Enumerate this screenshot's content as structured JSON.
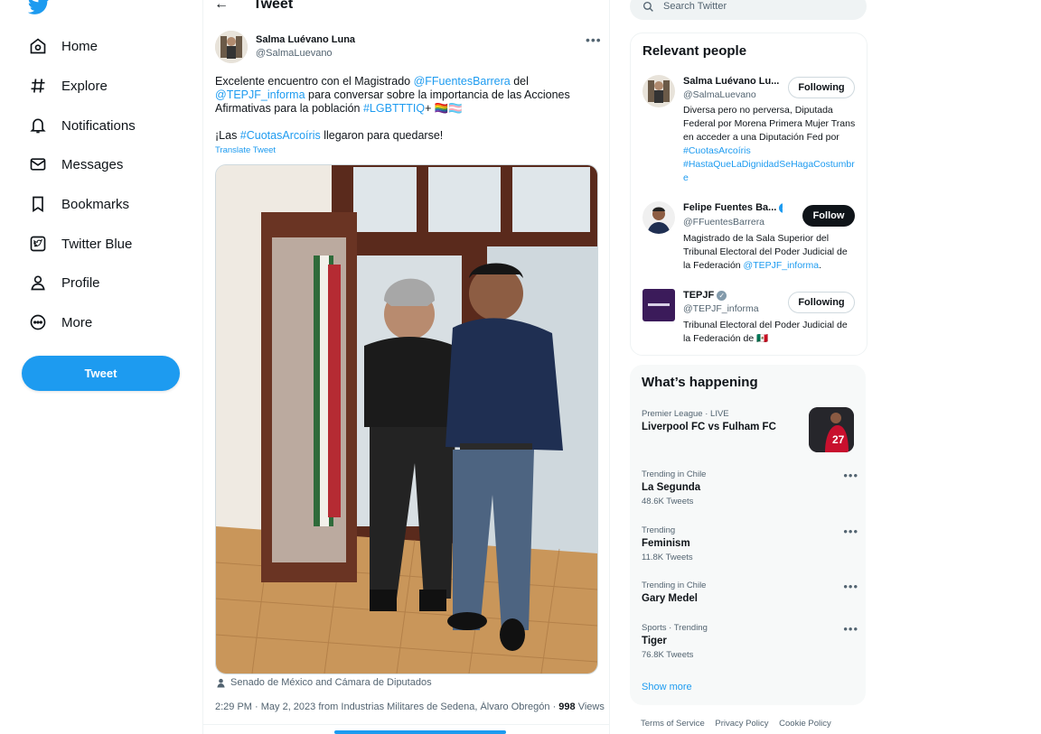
{
  "nav": {
    "logo": "twitter-bird-icon",
    "items": [
      {
        "label": "Home",
        "icon": "home-icon"
      },
      {
        "label": "Explore",
        "icon": "hashtag-icon"
      },
      {
        "label": "Notifications",
        "icon": "bell-icon"
      },
      {
        "label": "Messages",
        "icon": "envelope-icon"
      },
      {
        "label": "Bookmarks",
        "icon": "bookmark-icon"
      },
      {
        "label": "Twitter Blue",
        "icon": "twitter-blue-icon"
      },
      {
        "label": "Profile",
        "icon": "person-icon"
      },
      {
        "label": "More",
        "icon": "more-circle-icon"
      }
    ],
    "tweet_button": "Tweet"
  },
  "header": {
    "title": "Tweet"
  },
  "tweet": {
    "author_name": "Salma Luévano Luna",
    "author_handle": "@SalmaLuevano",
    "text_parts": {
      "p1_a": "Excelente encuentro con el Magistrado ",
      "p1_mention1": "@FFuentesBarrera",
      "p1_b": " del ",
      "p1_mention2": "@TEPJF_informa",
      "p1_c": " para conversar sobre la importancia de las Acciones Afirmativas para la población ",
      "p1_hashtag": "#LGBTTTIQ",
      "p1_d": "+ 🏳️‍🌈🏳️‍⚧️",
      "p2_a": "¡Las ",
      "p2_hashtag": "#CuotasArcoíris",
      "p2_b": " llegaron para quedarse!"
    },
    "translate": "Translate Tweet",
    "location": "Senado de México and Cámara de Diputados",
    "meta_text": "2:29 PM · May 2, 2023 from Industrias Militares de Sedena, Álvaro Obregón · ",
    "views_count": "998",
    "views_label": " Views"
  },
  "search": {
    "placeholder": "Search Twitter"
  },
  "relevant": {
    "title": "Relevant people",
    "people": [
      {
        "name": "Salma Luévano Lu...",
        "handle": "@SalmaLuevano",
        "button": "Following",
        "bio_text": "Diversa pero no perversa, Diputada Federal por Morena Primera Mujer Trans en acceder a una Diputación Fed por ",
        "bio_link1": "#CuotasArcoíris",
        "bio_link2": "#HastaQueLaDignidadSeHagaCostumbre"
      },
      {
        "name": "Felipe Fuentes Ba...",
        "handle": "@FFuentesBarrera",
        "button": "Follow",
        "bio_text": "Magistrado de la Sala Superior del Tribunal Electoral del Poder Judicial de la Federación ",
        "bio_link1": "@TEPJF_informa",
        "bio_after": "."
      },
      {
        "name": "TEPJF",
        "handle": "@TEPJF_informa",
        "button": "Following",
        "bio_text": "Tribunal Electoral del Poder Judicial de la Federación de 🇲🇽"
      }
    ]
  },
  "happening": {
    "title": "What’s happening",
    "trends": [
      {
        "context": "Premier League · LIVE",
        "name": "Liverpool FC vs Fulham FC",
        "count": ""
      },
      {
        "context": "Trending in Chile",
        "name": "La Segunda",
        "count": "48.6K Tweets"
      },
      {
        "context": "Trending",
        "name": "Feminism",
        "count": "11.8K Tweets"
      },
      {
        "context": "Trending in Chile",
        "name": "Gary Medel",
        "count": ""
      },
      {
        "context": "Sports · Trending",
        "name": "Tiger",
        "count": "76.8K Tweets"
      }
    ],
    "show_more": "Show more"
  },
  "footer": {
    "links": [
      "Terms of Service",
      "Privacy Policy",
      "Cookie Policy"
    ]
  },
  "colors": {
    "accent": "#1d9bf0",
    "text": "#0f1419",
    "muted": "#536471"
  }
}
